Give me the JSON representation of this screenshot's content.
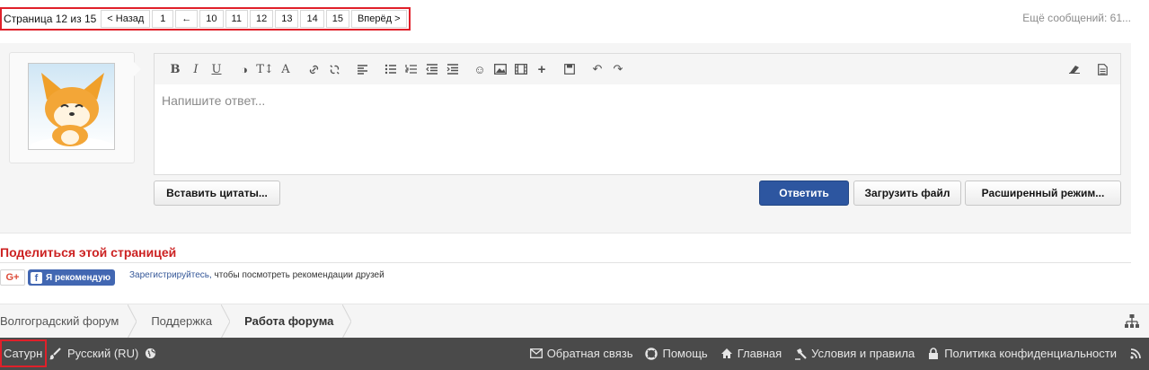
{
  "pagination": {
    "info": "Страница 12 из 15",
    "prev": "< Назад",
    "first": "1",
    "gap": "←",
    "pages": [
      "10",
      "11",
      "12",
      "13",
      "14",
      "15"
    ],
    "next": "Вперёд >"
  },
  "more_messages": "Ещё сообщений: 61...",
  "editor": {
    "placeholder": "Напишите ответ...",
    "icons": [
      "bold-icon",
      "italic-icon",
      "underline-icon",
      "color-icon",
      "font-size-icon",
      "font-icon",
      "link-icon",
      "unlink-icon",
      "align-left-icon",
      "bullet-list-icon",
      "number-list-icon",
      "outdent-icon",
      "indent-icon",
      "smilie-icon",
      "image-icon",
      "media-icon",
      "insert-more-icon",
      "save-draft-icon",
      "undo-icon",
      "redo-icon",
      "remove-format-icon",
      "bbcode-toggle-icon"
    ]
  },
  "buttons": {
    "insert_quotes": "Вставить цитаты...",
    "reply": "Ответить",
    "upload": "Загрузить файл",
    "advanced": "Расширенный режим..."
  },
  "share": {
    "title": "Поделиться этой страницей",
    "gplus": "G+",
    "fb_like": "Я рекомендую",
    "fb_register": "Зарегистрируйтесь,",
    "fb_note": " чтобы посмотреть рекомендации друзей"
  },
  "breadcrumbs": [
    "Волгоградский форум",
    "Поддержка",
    "Работа форума"
  ],
  "footer": {
    "style": "Сатурн",
    "language": "Русский (RU)",
    "links": [
      {
        "icon": "envelope-icon",
        "label": "Обратная связь"
      },
      {
        "icon": "lifebuoy-icon",
        "label": "Помощь"
      },
      {
        "icon": "home-icon",
        "label": "Главная"
      },
      {
        "icon": "gavel-icon",
        "label": "Условия и правила"
      },
      {
        "icon": "lock-icon",
        "label": "Политика конфиденциальности"
      }
    ],
    "rss_icon": "rss-icon"
  },
  "colors": {
    "accent": "#2d56a0",
    "share_title": "#cc2222",
    "highlight": "#e0202a",
    "footer_bg": "#4a4a4a"
  }
}
